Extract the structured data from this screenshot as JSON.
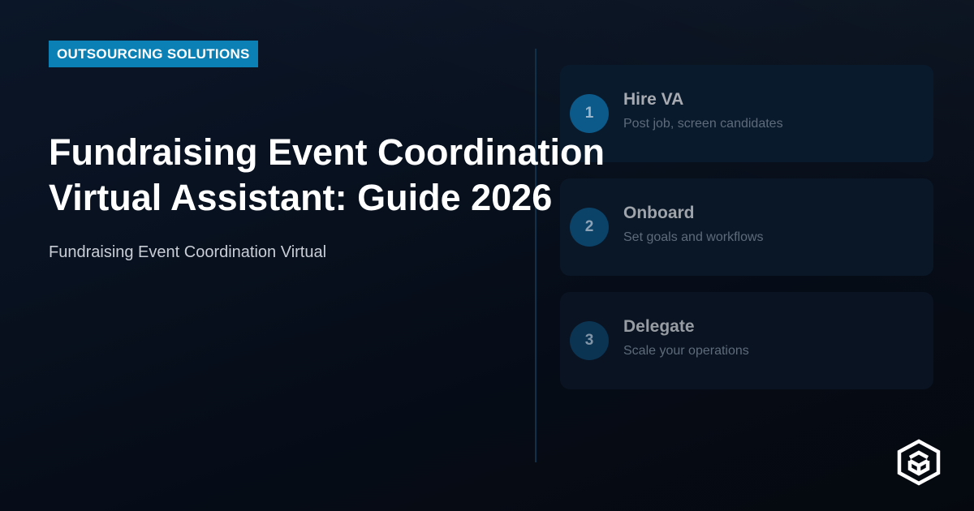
{
  "badge": {
    "label": "OUTSOURCING SOLUTIONS"
  },
  "headline": {
    "line1": "Fundraising Event Coordination",
    "line2": "Virtual Assistant: Guide 2026"
  },
  "subtitle": "Fundraising Event Coordination Virtual",
  "steps": [
    {
      "number": "1",
      "title": "Hire VA",
      "description": "Post job, screen candidates"
    },
    {
      "number": "2",
      "title": "Onboard",
      "description": "Set goals and workflows"
    },
    {
      "number": "3",
      "title": "Delegate",
      "description": "Scale your operations"
    }
  ],
  "logo": {
    "icon": "hexagon-cube-icon"
  },
  "colors": {
    "background": "#060c16",
    "badge": "#0b80b4",
    "step_circle": "#0c5a8a",
    "card": "#0a1a2d"
  }
}
